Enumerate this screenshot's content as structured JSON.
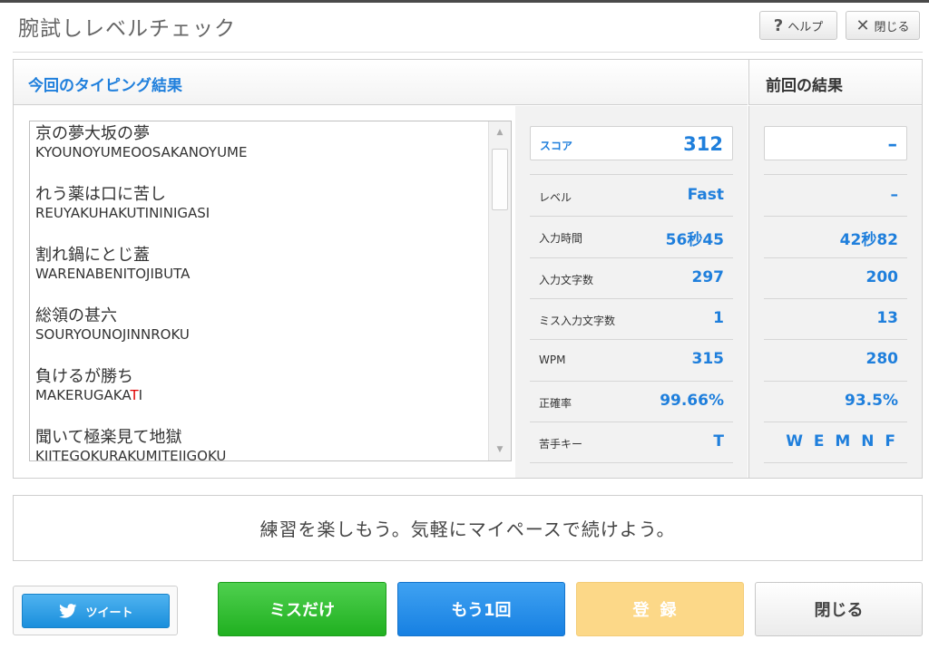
{
  "header": {
    "title": "腕試しレベルチェック",
    "help_icon": "?",
    "help_label": "ヘルプ",
    "close_icon": "✕",
    "close_label": "閉じる"
  },
  "results": {
    "current_title": "今回のタイピング結果",
    "previous_title": "前回の結果",
    "proverbs": [
      {
        "jp": "京の夢大坂の夢",
        "romaji": "KYOUNOYUMEOOSAKANOYUME"
      },
      {
        "jp": "れう薬は口に苦し",
        "romaji": "REUYAKUHAKUTININIGASI"
      },
      {
        "jp": "割れ鍋にとじ蓋",
        "romaji": "WARENABENITOJIBUTA"
      },
      {
        "jp": "総領の甚六",
        "romaji": "SOURYOUNOJINNROKU"
      },
      {
        "jp": "負けるが勝ち",
        "romaji_pre": "MAKERUGAKA",
        "romaji_err": "T",
        "romaji_post": "I"
      },
      {
        "jp": "聞いて極楽見て地獄",
        "romaji": "KIITEGOKURAKUMITEJIGOKU"
      }
    ],
    "stats": [
      {
        "label": "スコア",
        "current": "312",
        "previous": "–"
      },
      {
        "label": "レベル",
        "current": "Fast",
        "previous": "–"
      },
      {
        "label": "入力時間",
        "current": "56秒45",
        "previous": "42秒82"
      },
      {
        "label": "入力文字数",
        "current": "297",
        "previous": "200"
      },
      {
        "label": "ミス入力文字数",
        "current": "1",
        "previous": "13"
      },
      {
        "label": "WPM",
        "current": "315",
        "previous": "280"
      },
      {
        "label": "正確率",
        "current": "99.66%",
        "previous": "93.5%"
      },
      {
        "label": "苦手キー",
        "current": "T",
        "previous": "W E M N F"
      }
    ]
  },
  "message": "練習を楽しもう。気軽にマイペースで続けよう。",
  "buttons": {
    "tweet": "ツイート",
    "miss_only": "ミスだけ",
    "again": "もう1回",
    "register": "登録",
    "close": "閉じる"
  },
  "colors": {
    "accent_blue": "#1f7fdc",
    "error_red": "#e00000",
    "green": "#20b020",
    "blue_button": "#1780e2",
    "register_disabled": "#fcd888",
    "twitter": "#1a8fdc"
  }
}
